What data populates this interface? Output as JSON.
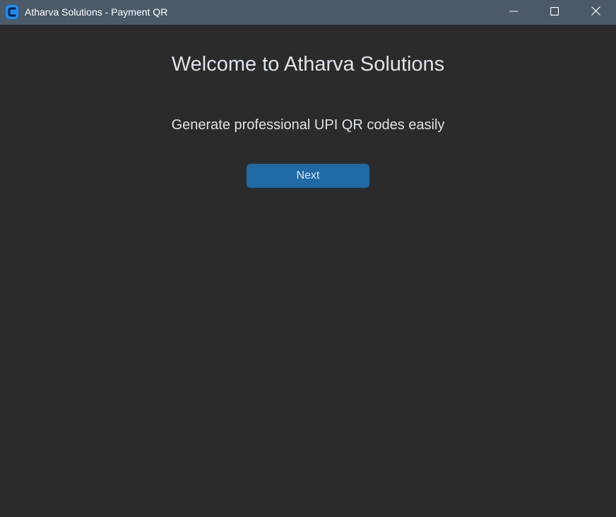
{
  "window": {
    "title": "Atharva Solutions - Payment QR",
    "icon": "app-logo-icon",
    "controls": {
      "minimize_icon": "minimize-icon",
      "maximize_icon": "maximize-icon",
      "close_icon": "close-icon"
    }
  },
  "main": {
    "heading": "Welcome to Atharva Solutions",
    "subtitle": "Generate professional UPI QR codes easily",
    "next_button_label": "Next"
  },
  "colors": {
    "titlebar": "#4a5a69",
    "background": "#2b2b2b",
    "accent": "#1f6aa5",
    "text": "#dce4ec"
  }
}
